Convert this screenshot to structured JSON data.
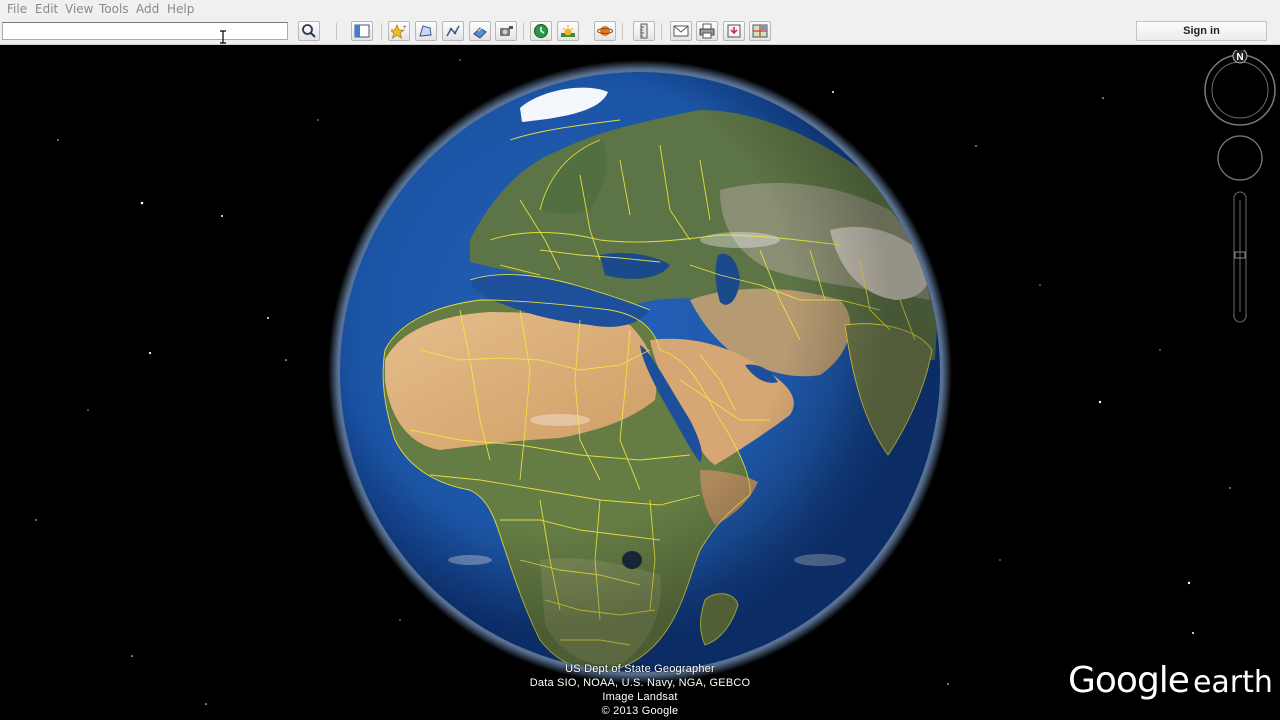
{
  "menu": {
    "items": [
      {
        "label": "File"
      },
      {
        "label": "Edit"
      },
      {
        "label": "View"
      },
      {
        "label": "Tools"
      },
      {
        "label": "Add"
      },
      {
        "label": "Help"
      }
    ]
  },
  "search": {
    "value": "",
    "placeholder": ""
  },
  "toolbar": {
    "buttons": [
      "search-icon",
      "sidebar-icon",
      "placemark-icon",
      "polygon-icon",
      "path-icon",
      "image-overlay-icon",
      "record-tour-icon",
      "historical-imagery-icon",
      "sunlight-icon",
      "planets-icon",
      "ruler-icon",
      "email-icon",
      "print-icon",
      "save-image-icon",
      "maps-view-icon"
    ],
    "sign_in_label": "Sign in"
  },
  "navigation": {
    "north_label": "N"
  },
  "attribution": {
    "line1": "US Dept of State Geographer",
    "line2": "Data SIO, NOAA, U.S. Navy, NGA, GEBCO",
    "line3": "Image Landsat",
    "line4": "© 2013 Google"
  },
  "brand": {
    "google": "Google",
    "earth": "earth"
  },
  "colors": {
    "space": "#000000",
    "ocean": "#1c57a8",
    "borders": "#f2ea3c",
    "toolbar": "#f0f0f0"
  }
}
